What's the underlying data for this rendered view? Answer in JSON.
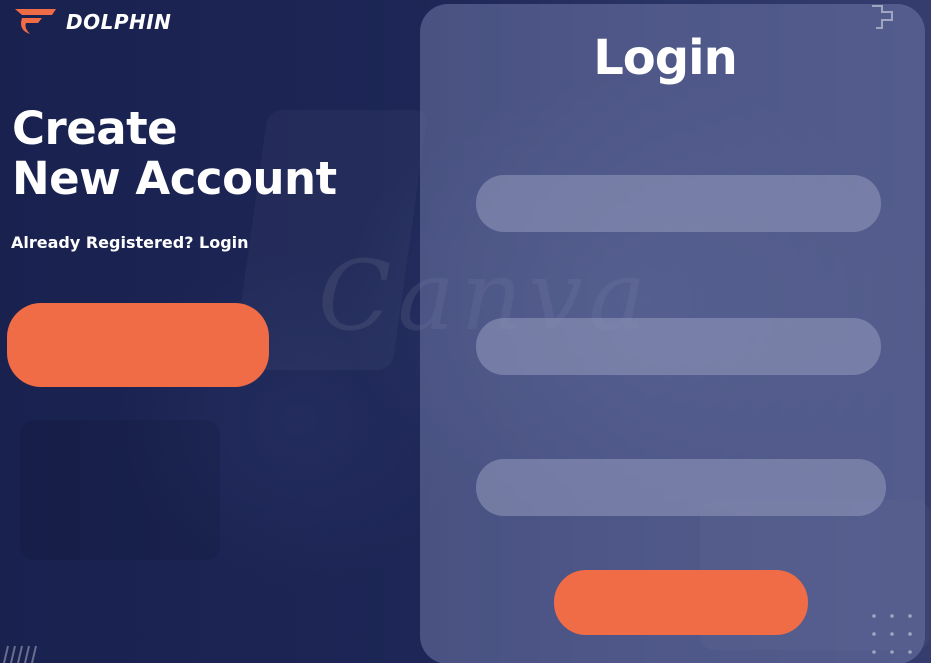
{
  "brand": {
    "name": "DOLPHIN",
    "icon": "dolphin-logo-icon"
  },
  "hero": {
    "title_line1": "Create",
    "title_line2": "New Account",
    "subtitle": "Already Registered? Login"
  },
  "login_panel": {
    "title": "Login",
    "fields": [
      {
        "value": "",
        "placeholder": ""
      },
      {
        "value": "",
        "placeholder": ""
      },
      {
        "value": "",
        "placeholder": ""
      }
    ]
  },
  "watermark": {
    "text": "Canva"
  },
  "colors": {
    "background": "#1a2250",
    "accent": "#f06c46",
    "panel": "#6e76a5",
    "field": "#9699be",
    "text": "#ffffff"
  }
}
